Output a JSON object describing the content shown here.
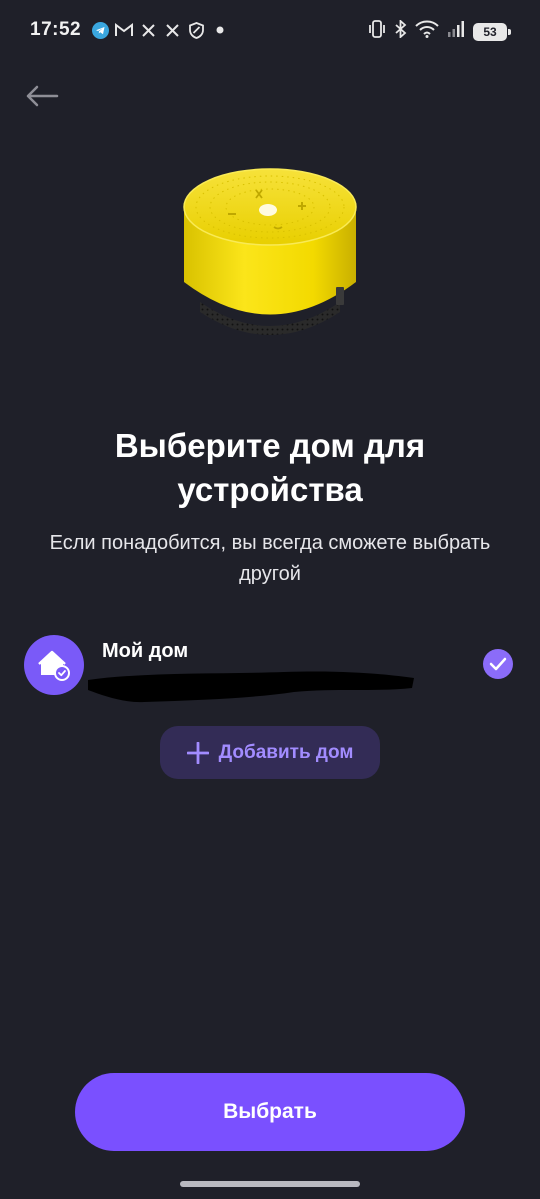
{
  "status_bar": {
    "time": "17:52",
    "left_icons": [
      "telegram-icon",
      "gmail-icon",
      "x-icon",
      "x-icon",
      "shield-icon",
      "dot-icon"
    ],
    "right_icons": [
      "vibrate-icon",
      "bluetooth-icon",
      "wifi-icon",
      "signal-icon"
    ],
    "battery": "53"
  },
  "header": {
    "back_icon": "arrow-left-icon"
  },
  "hero": {
    "image": "yellow-smart-speaker",
    "title": "Выберите дом для устройства",
    "subtitle": "Если понадобится, вы всегда сможете выбрать другой"
  },
  "homes": [
    {
      "name": "Мой дом",
      "icon": "home-icon",
      "selected": true
    }
  ],
  "add_home": {
    "label": "Добавить дом",
    "icon": "plus-icon"
  },
  "footer": {
    "select_label": "Выбрать"
  },
  "colors": {
    "background": "#1f2029",
    "accent": "#7a50ff",
    "accent_soft": "#332c56",
    "accent_text": "#a28cff"
  }
}
